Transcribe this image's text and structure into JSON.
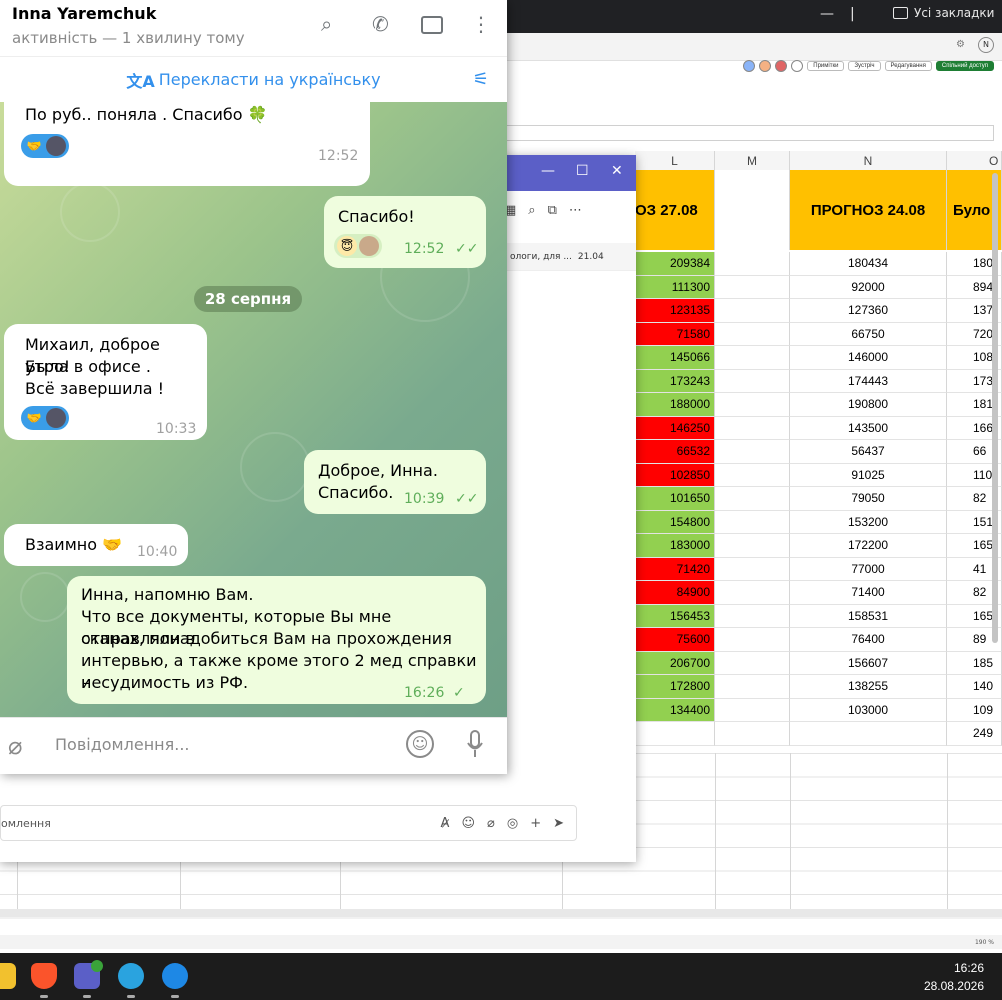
{
  "browser": {
    "bookmarks_label": "Усі закладки"
  },
  "sheet": {
    "toolbar": {
      "comments": "Примітки",
      "meet": "Зустріч",
      "edit": "Редагування",
      "share": "Спільний доступ"
    },
    "columns": [
      "L",
      "M",
      "N",
      "O"
    ],
    "headers": {
      "L": "ОЗ 27.08",
      "N": "ПРОГНОЗ 24.08",
      "O": "Було"
    },
    "colors": {
      "green": "#92d050",
      "red": "#ff0000",
      "yellow": "#ffc000"
    },
    "rows": [
      {
        "l": "209384",
        "l_color": "green",
        "n": "180434",
        "o": "180"
      },
      {
        "l": "111300",
        "l_color": "green",
        "n": "92000",
        "o": "894"
      },
      {
        "l": "123135",
        "l_color": "red",
        "n": "127360",
        "o": "137"
      },
      {
        "l": "71580",
        "l_color": "red",
        "n": "66750",
        "o": "720"
      },
      {
        "l": "145066",
        "l_color": "green",
        "n": "146000",
        "o": "108"
      },
      {
        "l": "173243",
        "l_color": "green",
        "n": "174443",
        "o": "173"
      },
      {
        "l": "188000",
        "l_color": "green",
        "n": "190800",
        "o": "181"
      },
      {
        "l": "146250",
        "l_color": "red",
        "n": "143500",
        "o": "166"
      },
      {
        "l": "66532",
        "l_color": "red",
        "n": "56437",
        "o": "66"
      },
      {
        "l": "102850",
        "l_color": "red",
        "n": "91025",
        "o": "110"
      },
      {
        "l": "101650",
        "l_color": "green",
        "n": "79050",
        "o": "82"
      },
      {
        "l": "154800",
        "l_color": "green",
        "n": "153200",
        "o": "151"
      },
      {
        "l": "183000",
        "l_color": "green",
        "n": "172200",
        "o": "165"
      },
      {
        "l": "71420",
        "l_color": "red",
        "n": "77000",
        "o": "41"
      },
      {
        "l": "84900",
        "l_color": "red",
        "n": "71400",
        "o": "82"
      },
      {
        "l": "156453",
        "l_color": "green",
        "n": "158531",
        "o": "165"
      },
      {
        "l": "75600",
        "l_color": "red",
        "n": "76400",
        "o": "89"
      },
      {
        "l": "206700",
        "l_color": "green",
        "n": "156607",
        "o": "185"
      },
      {
        "l": "172800",
        "l_color": "green",
        "n": "138255",
        "o": "140"
      },
      {
        "l": "134400",
        "l_color": "green",
        "n": "103000",
        "o": "109"
      },
      {
        "l": "",
        "l_color": "none",
        "n": "",
        "o": "249"
      }
    ],
    "zoom": "190 %"
  },
  "teams": {
    "chat_preview": "ологи, для ...",
    "chat_date": "21.04",
    "compose_placeholder": "омлення"
  },
  "telegram": {
    "contact_name": "Inna Yaremchuk",
    "status": "активність — 1 хвилину тому",
    "translate_label": "Перекласти на українську",
    "date_divider": "28 серпня",
    "input_placeholder": "Повідомлення...",
    "messages": [
      {
        "text": "По руб.. поняла . Спасибо 🍀",
        "time": "12:52"
      },
      {
        "text": "Спасибо!",
        "time": "12:52"
      },
      {
        "line1": "Михаил, доброе утро!",
        "line2": "Была в офисе .",
        "line3": "Всё завершила !",
        "time": "10:33"
      },
      {
        "line1": "Доброе, Инна.",
        "line2": "Спасибо.",
        "time": "10:39"
      },
      {
        "text": "Взаимно 🤝",
        "time": "10:40"
      },
      {
        "line1": "Инна, напомню Вам.",
        "line2": "Что все документы, которые Вы мне отправляли в",
        "line3": "сканах, понадобиться Вам на прохождения",
        "line4": "интервью, а также кроме этого 2 мед справки и",
        "line5": "несудимость из РФ.",
        "time": "16:26"
      }
    ]
  },
  "taskbar": {
    "time": "16:26",
    "date": "28.08.2026"
  }
}
